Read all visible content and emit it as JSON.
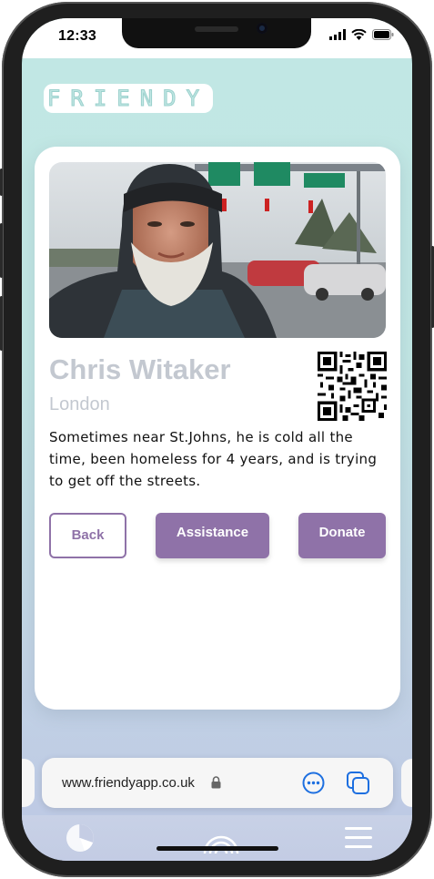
{
  "status": {
    "time": "12:33"
  },
  "app": {
    "logo_text": "FRIENDY"
  },
  "profile": {
    "name": "Chris Witaker",
    "location": "London",
    "description": "Sometimes near St.Johns, he is cold all the time, been homeless for 4 years, and is trying to get off the streets."
  },
  "actions": {
    "back_label": "Back",
    "assistance_label": "Assistance",
    "donate_label": "Donate"
  },
  "browser": {
    "url": "www.friendyapp.co.uk"
  },
  "colors": {
    "accent": "#8f72a8",
    "teal": "#c1e7e4",
    "name_gray": "#c3c8d0",
    "link_blue": "#1d6fe0"
  },
  "icons": [
    "signal-icon",
    "wifi-icon",
    "battery-icon",
    "lock-icon",
    "more-icon",
    "tabs-icon",
    "pie-chart-icon",
    "radar-icon",
    "menu-icon"
  ]
}
